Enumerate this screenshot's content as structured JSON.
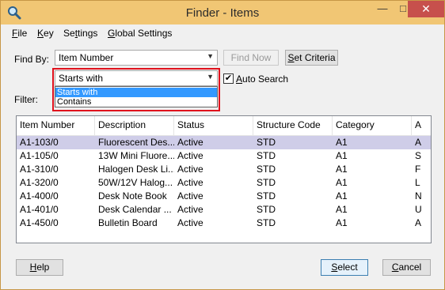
{
  "window": {
    "title": "Finder - Items",
    "minimize": "—",
    "maximize": "□",
    "close": "✕"
  },
  "menu": {
    "file": {
      "key": "F",
      "rest": "ile"
    },
    "key": {
      "key": "K",
      "rest": "ey"
    },
    "settings": {
      "pre": "Se",
      "key": "t",
      "rest": "tings"
    },
    "global": {
      "key": "G",
      "rest": "lobal Settings"
    }
  },
  "find_by": {
    "label": "Find By:",
    "value": "Item Number",
    "find_now": "Find Now",
    "set_criteria": {
      "key": "S",
      "rest": "et Criteria"
    }
  },
  "match": {
    "value": "Starts with",
    "options": [
      "Starts with",
      "Contains"
    ],
    "selected_index": 0,
    "auto_search": {
      "pre": "",
      "key": "A",
      "rest": "uto Search",
      "checked": true
    }
  },
  "filter": {
    "label": "Filter:"
  },
  "table": {
    "columns": [
      "Item Number",
      "Description",
      "Status",
      "Structure Code",
      "Category",
      "A"
    ],
    "rows": [
      [
        "A1-103/0",
        "Fluorescent Des...",
        "Active",
        "STD",
        "A1",
        "A"
      ],
      [
        "A1-105/0",
        "13W Mini Fluore...",
        "Active",
        "STD",
        "A1",
        "S"
      ],
      [
        "A1-310/0",
        "Halogen Desk Li...",
        "Active",
        "STD",
        "A1",
        "F"
      ],
      [
        "A1-320/0",
        "50W/12V Halog...",
        "Active",
        "STD",
        "A1",
        "L"
      ],
      [
        "A1-400/0",
        "Desk Note Book",
        "Active",
        "STD",
        "A1",
        "N"
      ],
      [
        "A1-401/0",
        "Desk Calendar ...",
        "Active",
        "STD",
        "A1",
        "U"
      ],
      [
        "A1-450/0",
        "Bulletin Board",
        "Active",
        "STD",
        "A1",
        "A"
      ]
    ],
    "selected_row": 0
  },
  "buttons": {
    "help": {
      "key": "H",
      "rest": "elp"
    },
    "select": {
      "key": "S",
      "rest": "elect"
    },
    "cancel": {
      "key": "C",
      "rest": "ancel"
    }
  },
  "colors": {
    "title_bar": "#f1c674",
    "close_button": "#c7504c",
    "selected_row": "#cfcde8",
    "dropdown_highlight": "#3399ff",
    "annotation": "#e0121d"
  },
  "icons": {
    "app": "magnifier-icon",
    "dropdown": "chevron-down-icon",
    "check": "checkmark-icon"
  }
}
